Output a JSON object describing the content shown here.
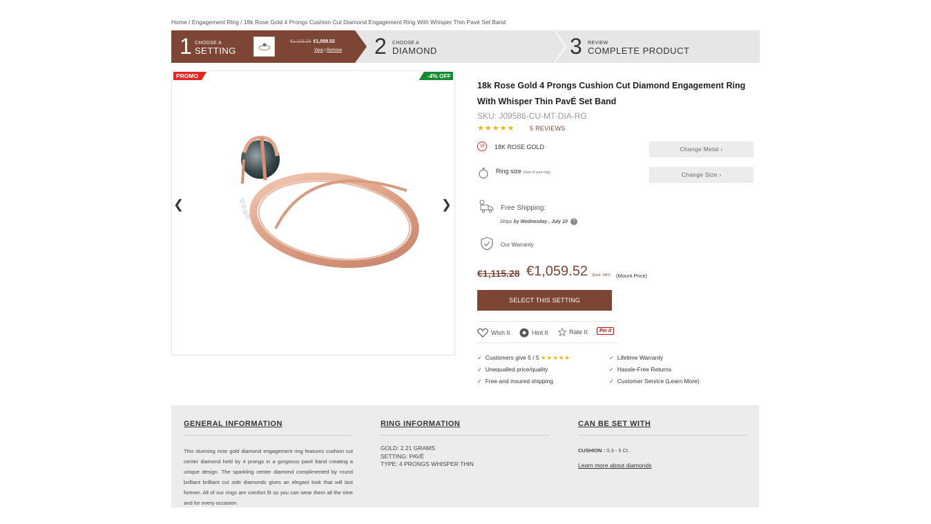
{
  "breadcrumb": {
    "items": [
      "Home",
      "Engagement Ring",
      "18k Rose Gold 4 Prongs Cushion Cut Diamond Engagement Ring With Whisper Thin Pavé Set Band"
    ],
    "separator": " / "
  },
  "stepper": {
    "step1": {
      "number": "1",
      "small": "CHOOSE A",
      "big": "SETTING",
      "old_price": "€1,115.28",
      "price": "€1,059.52",
      "view": "View",
      "remove": "Remove",
      "link_sep": " | "
    },
    "step2": {
      "number": "2",
      "small": "CHOOSE A",
      "big": "DIAMOND"
    },
    "step3": {
      "number": "3",
      "small": "REVIEW",
      "big": "COMPLETE PRODUCT"
    }
  },
  "gallery": {
    "promo_badge": "PROMO",
    "off_badge": "-4% OFF",
    "prev": "❮",
    "next": "❯"
  },
  "product": {
    "title": "18k Rose Gold 4 Prongs Cushion Cut Diamond Engagement Ring With Whisper Thin PavÉ Set Band",
    "sku": "SKU: J09586-CU-MT-DIA-RG",
    "stars": "★★★★★",
    "reviews": "5 REVIEWS",
    "metal_icon_text": "18",
    "metal": "18K ROSE GOLD",
    "change_metal": "Change Metal ›",
    "ring_size_label": "Ring size",
    "ring_size_hint": "(Size of your ring)",
    "change_size": "Change Size ›",
    "shipping_label": "Free Shipping:",
    "ships_prefix": "Ships ",
    "ships_by": "by Wednesday , July 10",
    "help": "?",
    "warranty": "Our Warranty",
    "old_price": "€1,115.28",
    "price": "€1,059.52",
    "vat": "(Excl. VAT)",
    "mount": "(Mount Price)",
    "select_button": "SELECT THIS SETTING",
    "wish": "Wish It",
    "hint": "Hint It",
    "rate": "Rate It",
    "pinit": "Pin it"
  },
  "features": {
    "f1": "Customers give 5 / 5",
    "f1_stars": "★★★★★",
    "f2": "Unequalled price/quality",
    "f3": "Free and insured shipping",
    "f4": "Lifetime Warranty",
    "f5": "Hassle-Free Returns",
    "f6": "Customer Service (Learn More)"
  },
  "info": {
    "general_title": "GENERAL INFORMATION",
    "general_text": "This stunning rose gold diamond engagement ring features cushion cut center diamond held by 4 prongs in a gorgeous pavé band creating a unique design. The sparkling center diamond complimented by round brilliant brilliant cut side diamonds gives an elegant look that will last forever. All of our rings are comfort fit so you can wear them all the time and for every occasion.",
    "ring_title": "RING INFORMATION",
    "gold": "GOLD: 2.21 GRAMS",
    "setting": "SETTING: PAVÉ",
    "type": "TYPE: 4 PRONGS WHISPER THIN",
    "can_set_title": "CAN BE SET WITH",
    "cushion_label": "CUSHION :",
    "cushion_value": " 0.3 - 5 Ct.",
    "learn_more": "Learn more about diamonds"
  },
  "colors": {
    "brand": "#7d4533",
    "promo": "#e52421",
    "off": "#168a2e",
    "star": "#f5b301"
  }
}
